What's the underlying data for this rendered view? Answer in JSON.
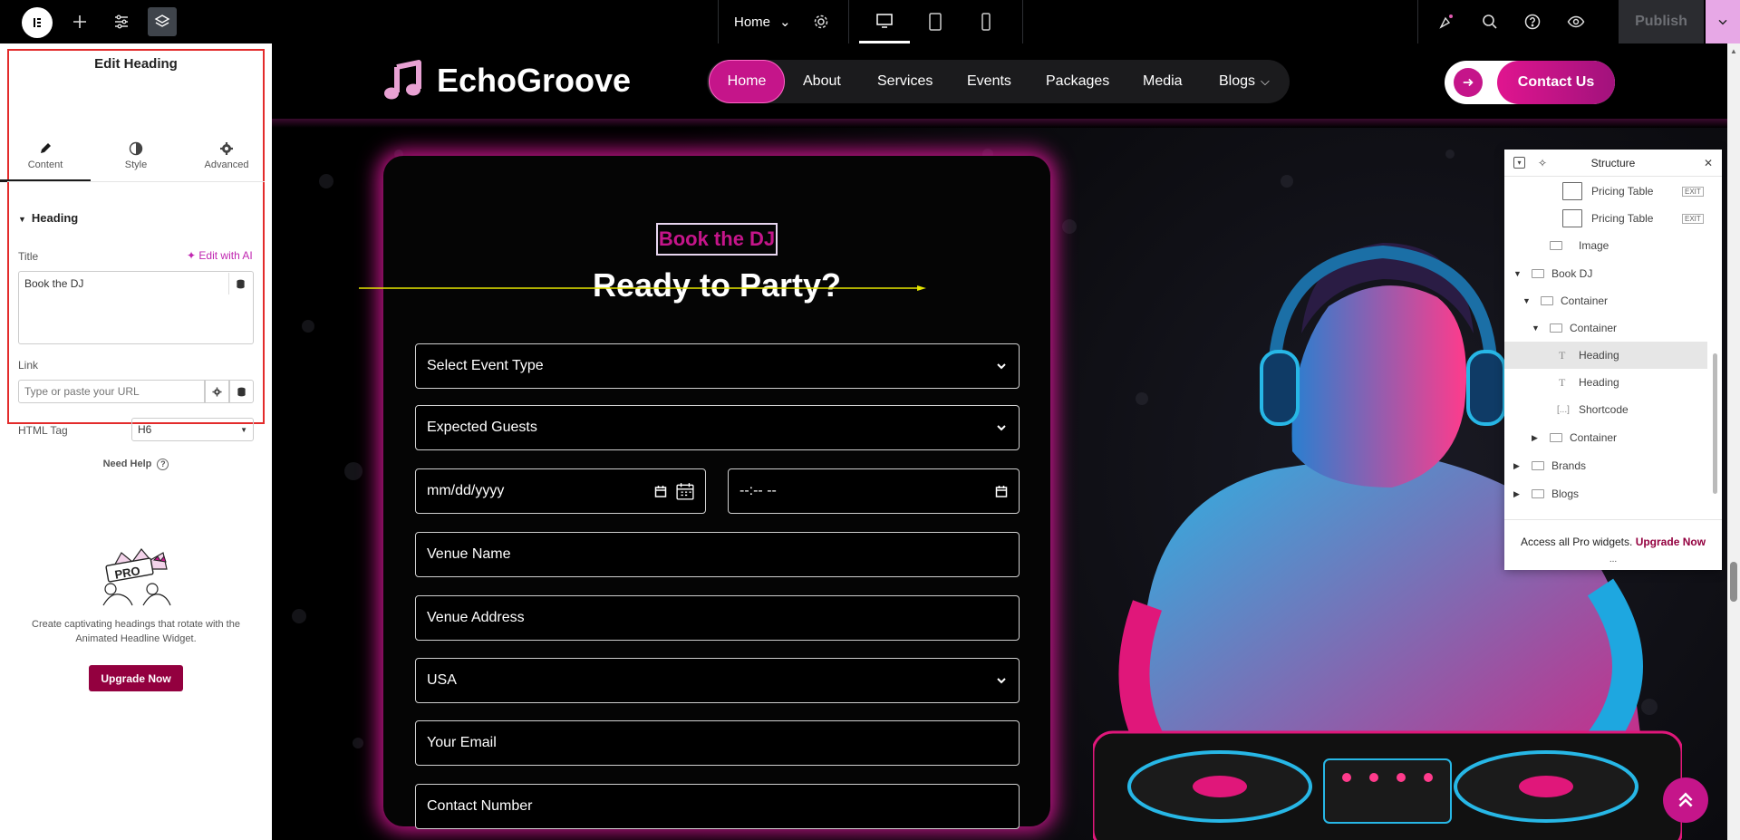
{
  "topbar": {
    "page_name": "Home",
    "publish_label": "Publish"
  },
  "panel": {
    "title": "Edit Heading",
    "tabs": [
      {
        "label": "Content",
        "icon": "pencil-icon"
      },
      {
        "label": "Style",
        "icon": "half-circle-icon"
      },
      {
        "label": "Advanced",
        "icon": "gear-icon"
      }
    ],
    "section_heading": "Heading",
    "title_label": "Title",
    "edit_ai_label": "Edit with AI",
    "title_value": "Book the DJ",
    "link_label": "Link",
    "link_placeholder": "Type or paste your URL",
    "html_tag_label": "HTML Tag",
    "html_tag_value": "H6",
    "need_help": "Need Help",
    "promo_text": "Create captivating headings that rotate with the Animated Headline Widget.",
    "upgrade_label": "Upgrade Now",
    "pro_badge": "PRO"
  },
  "site": {
    "brand": "EchoGroove",
    "nav": [
      "Home",
      "About",
      "Services",
      "Events",
      "Packages",
      "Media",
      "Blogs"
    ],
    "cta_label": "Contact Us",
    "selected_heading": "Book the DJ",
    "form_title": "Ready to Party?",
    "fields": {
      "event_type": "Select Event Type",
      "guests": "Expected Guests",
      "date": "mm/dd/yyyy",
      "time": "--:-- --",
      "venue_name": "Venue Name",
      "venue_address": "Venue Address",
      "country": "USA",
      "email": "Your Email",
      "contact": "Contact Number"
    },
    "accent_color": "#c5158a"
  },
  "structure": {
    "title": "Structure",
    "exit_label": "EXIT",
    "rows": [
      {
        "name": "Pricing Table"
      },
      {
        "name": "Pricing Table"
      },
      {
        "name": "Image"
      },
      {
        "name": "Book DJ"
      },
      {
        "name": "Container"
      },
      {
        "name": "Container"
      },
      {
        "name": "Heading"
      },
      {
        "name": "Heading"
      },
      {
        "name": "Shortcode"
      },
      {
        "name": "Container"
      },
      {
        "name": "Brands"
      },
      {
        "name": "Blogs"
      }
    ],
    "footer_text": "Access all Pro widgets.",
    "footer_link": "Upgrade Now",
    "more": "..."
  }
}
